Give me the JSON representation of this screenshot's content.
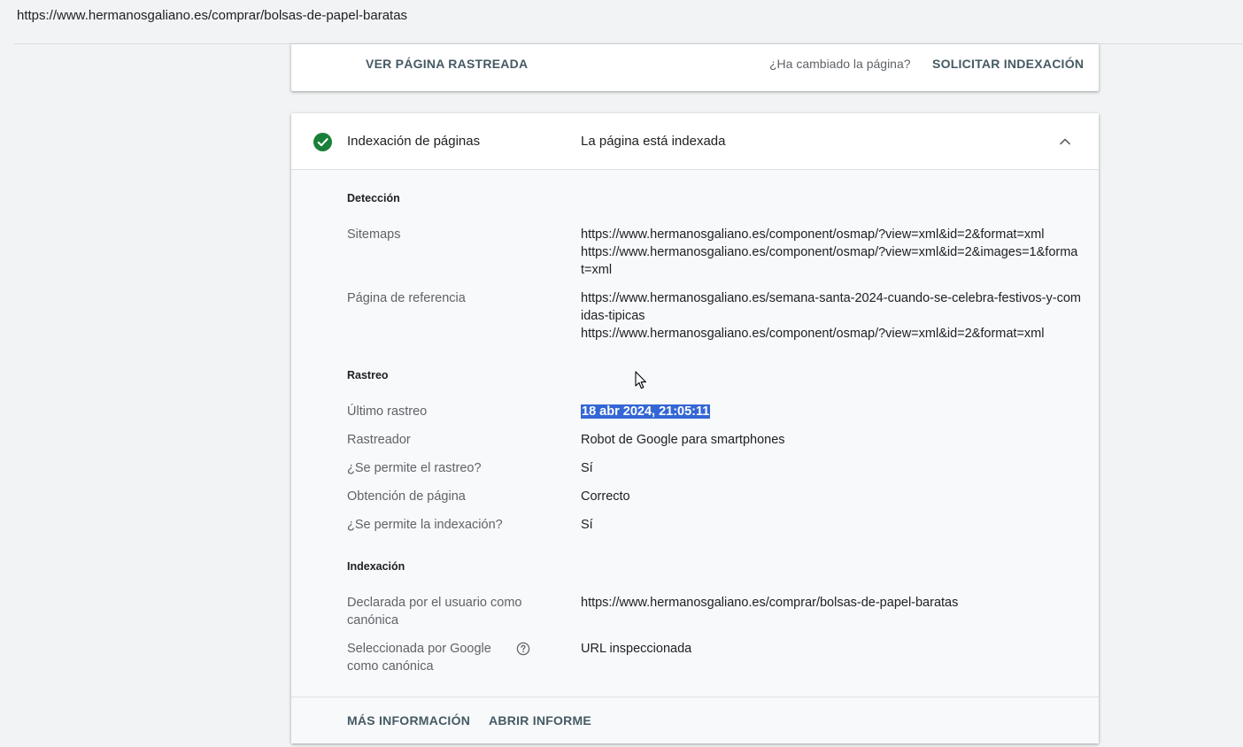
{
  "address_bar": {
    "url": "https://www.hermanosgaliano.es/comprar/bolsas-de-papel-baratas"
  },
  "actions_card": {
    "view_crawled_label": "VER PÁGINA RASTREADA",
    "changed_question": "¿Ha cambiado la página?",
    "request_indexing_label": "SOLICITAR INDEXACIÓN"
  },
  "indexing_card": {
    "header_label": "Indexación de páginas",
    "header_status": "La página está indexada",
    "status_icon": "check-circle-icon",
    "status_color": "#188038",
    "detection": {
      "title": "Detección",
      "sitemaps_label": "Sitemaps",
      "sitemaps": [
        "https://www.hermanosgaliano.es/component/osmap/?view=xml&id=2&format=xml",
        "https://www.hermanosgaliano.es/component/osmap/?view=xml&id=2&images=1&format=xml"
      ],
      "referrer_label": "Página de referencia",
      "referrers": [
        "https://www.hermanosgaliano.es/semana-santa-2024-cuando-se-celebra-festivos-y-comidas-tipicas",
        "https://www.hermanosgaliano.es/component/osmap/?view=xml&id=2&format=xml"
      ]
    },
    "crawl": {
      "title": "Rastreo",
      "last_crawl_label": "Último rastreo",
      "last_crawl_value": "18 abr 2024, 21:05:11",
      "crawler_label": "Rastreador",
      "crawler_value": "Robot de Google para smartphones",
      "crawl_allowed_label": "¿Se permite el rastreo?",
      "crawl_allowed_value": "Sí",
      "page_fetch_label": "Obtención de página",
      "page_fetch_value": "Correcto",
      "index_allowed_label": "¿Se permite la indexación?",
      "index_allowed_value": "Sí"
    },
    "indexing": {
      "title": "Indexación",
      "user_canonical_label": "Declarada por el usuario como canónica",
      "user_canonical_value": "https://www.hermanosgaliano.es/comprar/bolsas-de-papel-baratas",
      "google_canonical_label": "Seleccionada por Google como canónica",
      "google_canonical_value": "URL inspeccionada"
    },
    "footer": {
      "more_info_label": "MÁS INFORMACIÓN",
      "open_report_label": "ABRIR INFORME"
    }
  }
}
